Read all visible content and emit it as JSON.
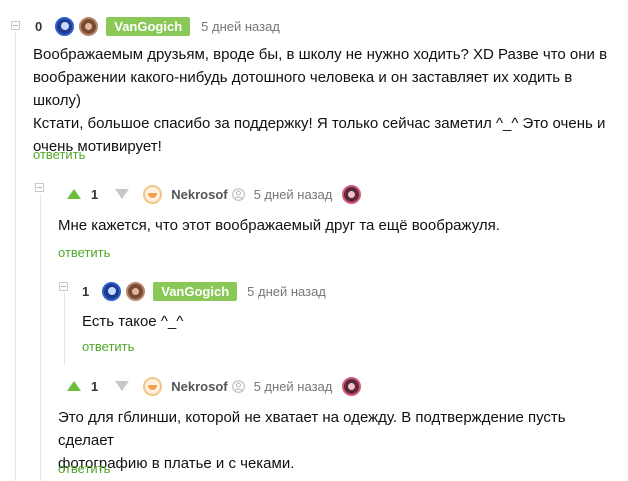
{
  "comments": [
    {
      "rating": "0",
      "author": "VanGogich",
      "time": "5 дней назад",
      "text_lines": [
        "Воображаемым друзьям, вроде бы, в школу не нужно ходить? XD Разве что они в",
        "воображении какого-нибудь дотошного человека и он заставляет их ходить в школу)",
        "Кстати, большое спасибо за поддержку! Я только сейчас заметил ^_^ Это очень и",
        "очень мотивирует!"
      ],
      "reply_label": "ответить"
    },
    {
      "rating": "1",
      "author": "Nekrosof",
      "time": "5 дней назад",
      "text_lines": [
        "Мне кажется, что этот воображаемый друг та ещё воображуля."
      ],
      "reply_label": "ответить"
    },
    {
      "rating": "1",
      "author": "VanGogich",
      "time": "5 дней назад",
      "text_lines": [
        "Есть такое ^_^"
      ],
      "reply_label": "ответить"
    },
    {
      "rating": "1",
      "author": "Nekrosof",
      "time": "5 дней назад",
      "text_lines": [
        "Это для гблинши, которой не хватает на одежду. В подтверждение пусть сделает",
        "фотографию в платье и с чеками."
      ],
      "reply_label": "ответить"
    }
  ],
  "icons": {
    "vote_up": "triangle-up-icon",
    "vote_down": "triangle-down-icon",
    "user": "user-outline-icon",
    "collapse": "collapse-minus-icon"
  },
  "colors": {
    "author_badge": "#8ac858",
    "reply_link": "#51a82a",
    "upvote": "#6cbf3a",
    "downvote": "#c8c8c8",
    "thread_line": "#e6e6e6"
  }
}
